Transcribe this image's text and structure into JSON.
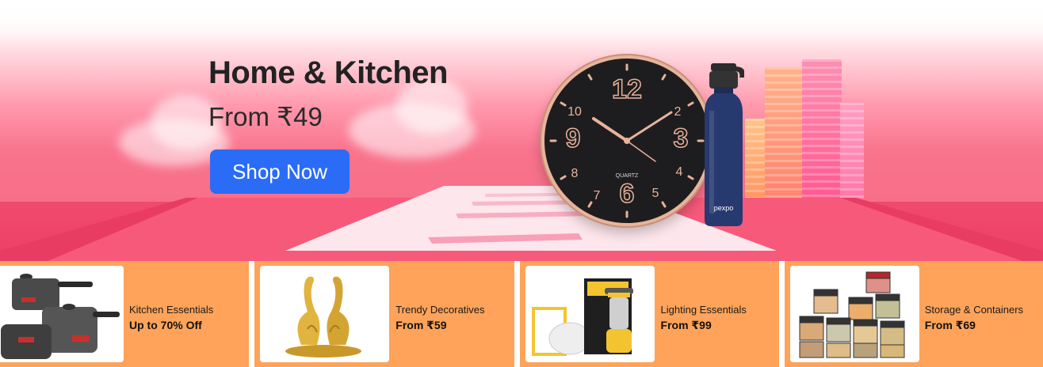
{
  "banner": {
    "title": "Home & Kitchen",
    "subtitle": "From ₹49",
    "cta_label": "Shop Now",
    "clock_brand": "QUARTZ",
    "bottle_brand": "pexpo",
    "clock_numbers": [
      "12",
      "2",
      "3",
      "4",
      "5",
      "6",
      "7",
      "8",
      "9",
      "10"
    ]
  },
  "promos": [
    {
      "name": "Kitchen Essentials",
      "offer": "Up to 70% Off",
      "image": "pressure-cooker-set"
    },
    {
      "name": "Trendy Decoratives",
      "offer": "From ₹59",
      "image": "golden-swan-pair"
    },
    {
      "name": "Lighting Essentials",
      "offer": "From ₹99",
      "image": "led-lantern-and-panel"
    },
    {
      "name": "Storage & Containers",
      "offer": "From ₹69",
      "image": "container-stack"
    }
  ],
  "colors": {
    "cta_blue": "#2a6cf6",
    "promo_orange": "#fea359",
    "banner_pink": "#f56a84"
  }
}
